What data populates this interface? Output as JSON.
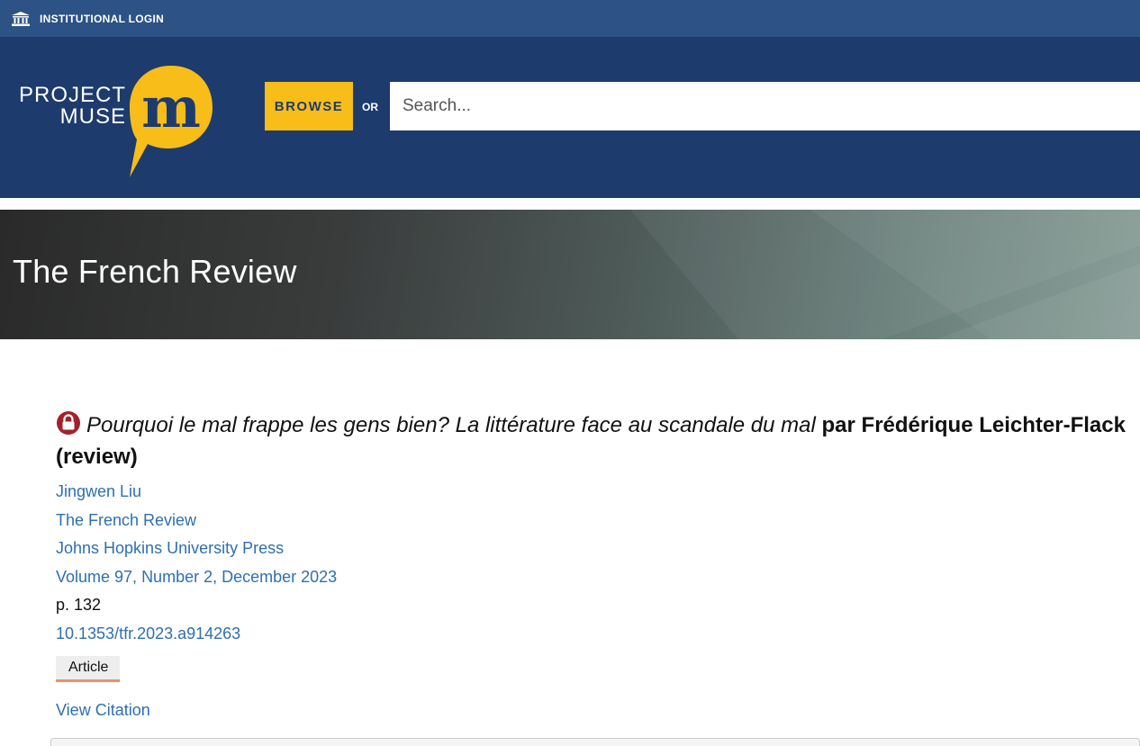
{
  "topbar": {
    "icon": "institution-icon",
    "label": "INSTITUTIONAL LOGIN"
  },
  "header": {
    "logo": {
      "line1": "PROJECT",
      "line2": "MUSE",
      "mark": "m"
    },
    "browse_label": "BROWSE",
    "or_label": "OR",
    "search_placeholder": "Search..."
  },
  "banner": {
    "title": "The French Review"
  },
  "article": {
    "lock_icon": "lock-icon",
    "title_italic": "Pourquoi le mal frappe les gens bien? La littérature face au scandale du mal",
    "title_rest": " par Frédérique Leichter-Flack (review)",
    "author": "Jingwen Liu",
    "journal": "The French Review",
    "publisher": "Johns Hopkins University Press",
    "issue": "Volume 97, Number 2, December 2023",
    "pages": "p. 132",
    "doi": "10.1353/tfr.2023.a914263",
    "type_badge": "Article",
    "view_citation": "View Citation"
  },
  "colors": {
    "topbar": "#2c5286",
    "header": "#1d3b6d",
    "accent_yellow": "#f8bd19",
    "link": "#2e6fb0",
    "badge_underline": "#e8926b",
    "lock": "#a3212b"
  }
}
